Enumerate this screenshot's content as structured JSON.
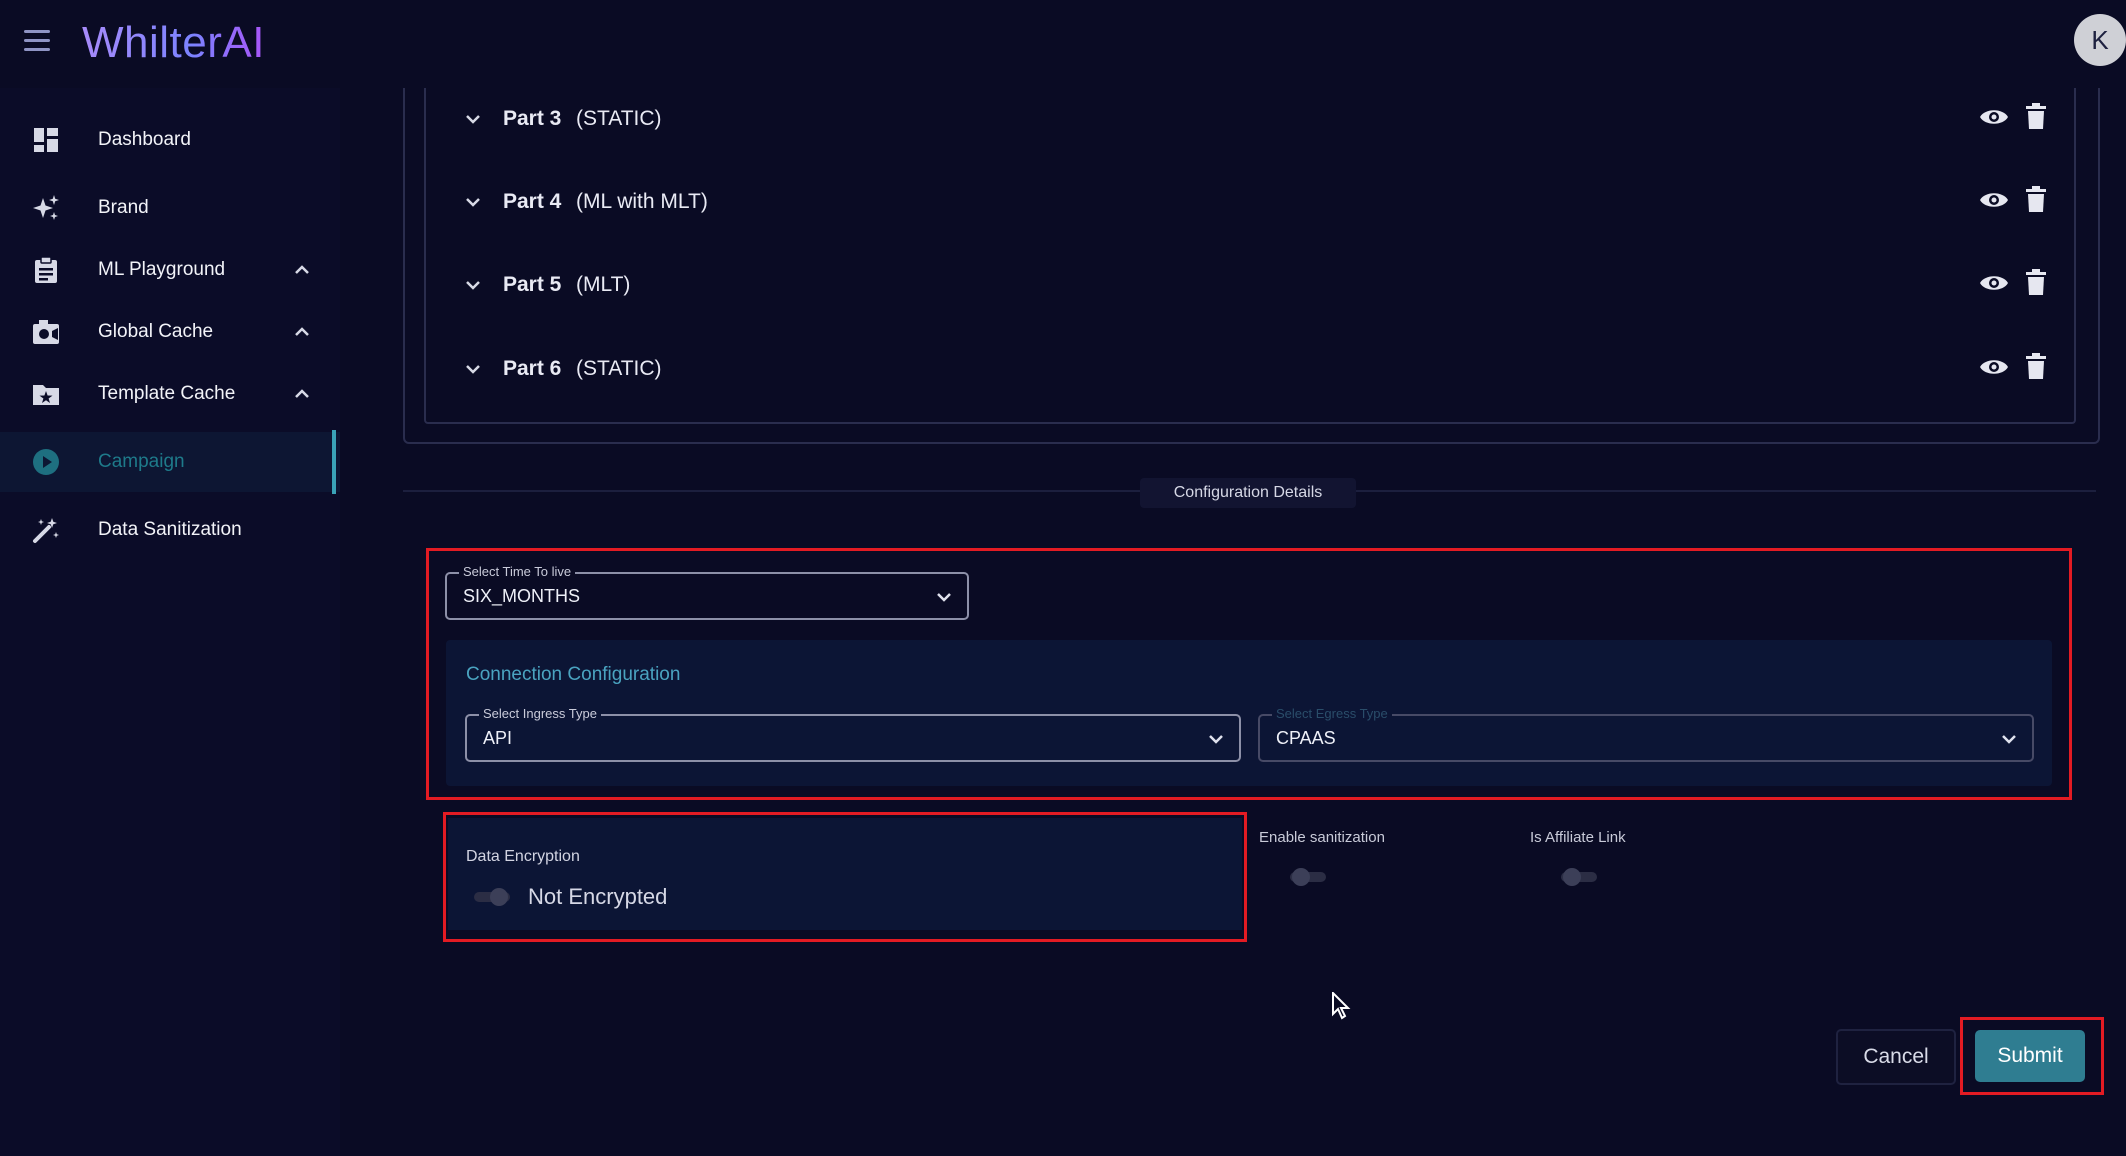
{
  "app": {
    "logo_text": "WhilterAI",
    "avatar_initial": "K"
  },
  "sidebar": {
    "items": [
      {
        "label": "Dashboard",
        "icon": "dashboard-icon"
      },
      {
        "label": "Brand",
        "icon": "sparkles-icon"
      },
      {
        "label": "ML Playground",
        "icon": "clipboard-icon",
        "expandable": true
      },
      {
        "label": "Global Cache",
        "icon": "camera-icon",
        "expandable": true
      },
      {
        "label": "Template Cache",
        "icon": "folder-star-icon",
        "expandable": true
      },
      {
        "label": "Campaign",
        "icon": "play-circle-icon",
        "active": true
      },
      {
        "label": "Data Sanitization",
        "icon": "magic-wand-icon"
      }
    ]
  },
  "parts": [
    {
      "name": "Part 3",
      "type": "(STATIC)"
    },
    {
      "name": "Part 4",
      "type": "(ML with MLT)"
    },
    {
      "name": "Part 5",
      "type": "(MLT)"
    },
    {
      "name": "Part 6",
      "type": "(STATIC)"
    }
  ],
  "config": {
    "section_label": "Configuration Details",
    "ttl": {
      "label": "Select Time To live",
      "value": "SIX_MONTHS"
    },
    "connection": {
      "title": "Connection Configuration",
      "ingress": {
        "label": "Select Ingress Type",
        "value": "API"
      },
      "egress": {
        "label": "Select Egress Type",
        "value": "CPAAS"
      }
    },
    "encryption": {
      "label": "Data Encryption",
      "state_text": "Not Encrypted",
      "enabled": false
    },
    "sanitization": {
      "label": "Enable sanitization",
      "enabled": false
    },
    "affiliate": {
      "label": "Is Affiliate Link",
      "enabled": false
    }
  },
  "actions": {
    "cancel_label": "Cancel",
    "submit_label": "Submit"
  },
  "colors": {
    "background": "#0a0b24",
    "accent": "#2f7d91",
    "highlight": "#e31b23",
    "active_nav": "#1e7a8a"
  }
}
